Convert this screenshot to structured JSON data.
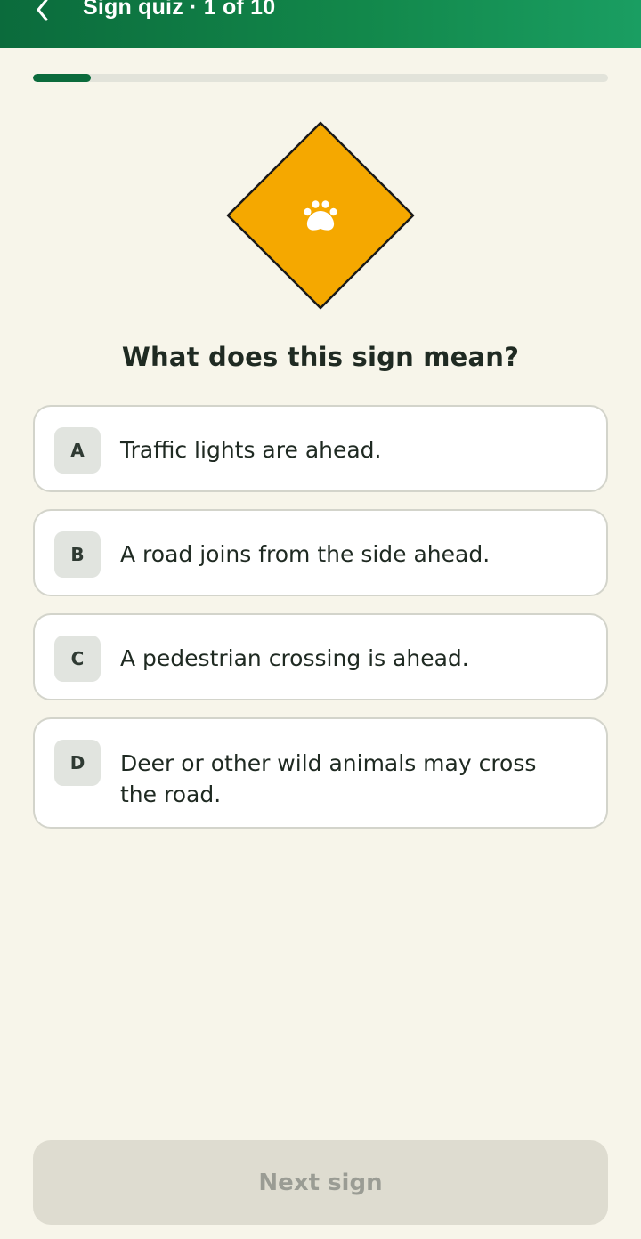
{
  "header": {
    "title": "Sign quiz · 1 of 10",
    "back_icon": "chevron-left-icon",
    "gradient_colors": [
      "#0b6b3c",
      "#1a9e62"
    ]
  },
  "progress": {
    "current": 1,
    "total": 10,
    "fill_color": "#0b6b3c"
  },
  "sign": {
    "shape": "diamond",
    "fill_color": "#f5a800",
    "border_color": "#1a1a1a",
    "icon": "paw-icon",
    "icon_color": "#ffffff"
  },
  "question": "What does this sign mean?",
  "options": [
    {
      "letter": "A",
      "text": "Traffic lights are ahead."
    },
    {
      "letter": "B",
      "text": "A road joins from the side ahead."
    },
    {
      "letter": "C",
      "text": "A pedestrian crossing is ahead."
    },
    {
      "letter": "D",
      "text": "Deer or other wild animals may cross the road."
    }
  ],
  "next_button": {
    "label": "Next sign",
    "disabled": true
  }
}
